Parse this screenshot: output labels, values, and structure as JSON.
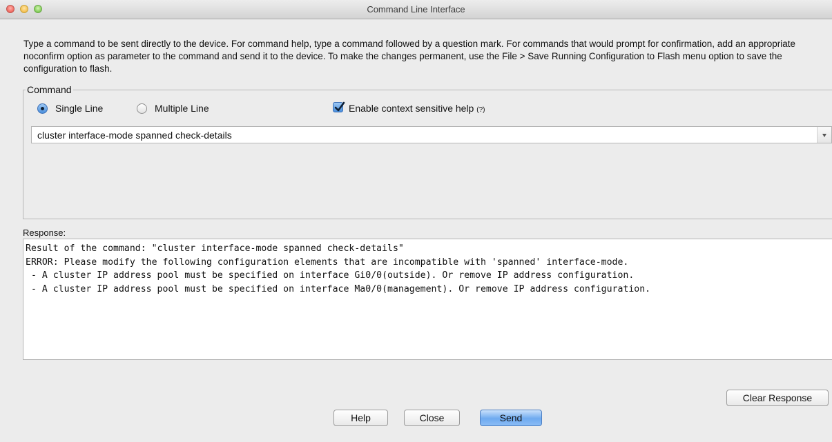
{
  "window": {
    "title": "Command Line Interface"
  },
  "description": "Type a command to be sent directly to the device. For command help, type a command followed by a question mark. For commands that would prompt for confirmation, add an appropriate noconfirm option as parameter to the command and send it to the device. To make the changes permanent, use the File > Save Running Configuration to Flash menu option to save the configuration to flash.",
  "command": {
    "group_label": "Command",
    "mode_options": [
      "Single Line",
      "Multiple Line"
    ],
    "selected_mode": "Single Line",
    "context_help_label": "Enable context sensitive help",
    "context_help_hint": "(?)",
    "context_help_checked": true,
    "input_value": "cluster interface-mode spanned check-details"
  },
  "response": {
    "label": "Response:",
    "lines": [
      "Result of the command: \"cluster interface-mode spanned check-details\"",
      "",
      "ERROR: Please modify the following configuration elements that are incompatible with 'spanned' interface-mode.",
      " - A cluster IP address pool must be specified on interface Gi0/0(outside). Or remove IP address configuration.",
      " - A cluster IP address pool must be specified on interface Ma0/0(management). Or remove IP address configuration."
    ]
  },
  "buttons": {
    "clear_response": "Clear Response",
    "help": "Help",
    "close": "Close",
    "send": "Send"
  },
  "colors": {
    "window_bg": "#ececec",
    "default_button": "#6eaaf0",
    "close_light": "#f0655b",
    "minimize_light": "#f4be4f",
    "zoom_light": "#7ccb54"
  }
}
